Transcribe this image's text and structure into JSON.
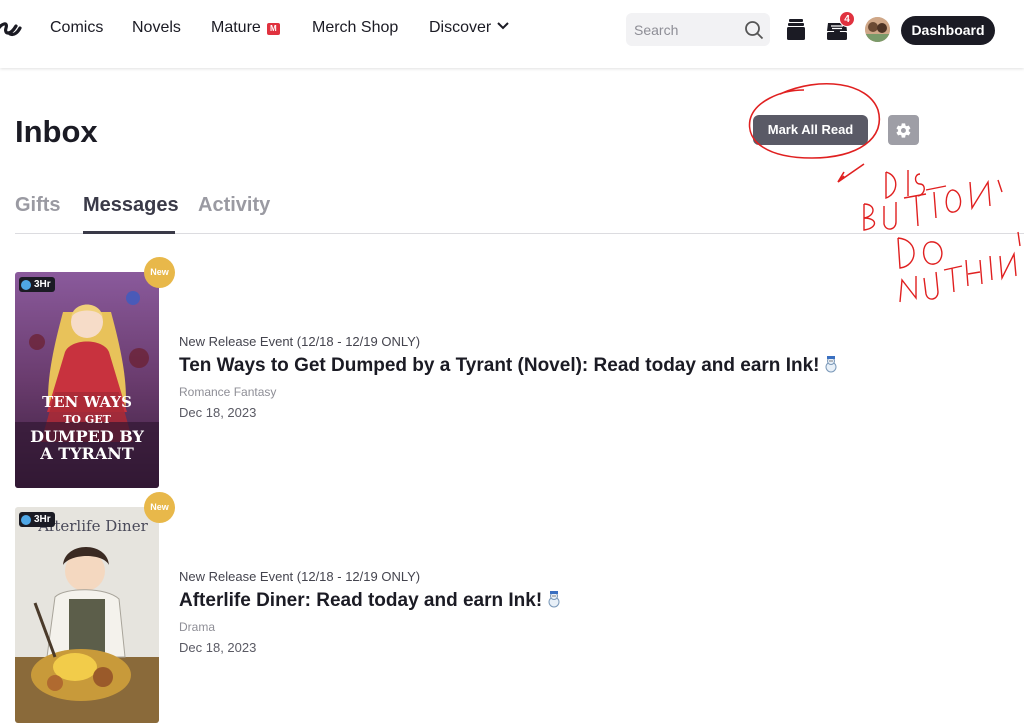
{
  "nav": {
    "logo_fragment": "s",
    "links": [
      "Comics",
      "Novels",
      "Mature",
      "Merch Shop",
      "Discover"
    ],
    "mature_badge": "M",
    "search_placeholder": "Search",
    "inbox_count": "4",
    "dashboard_label": "Dashboard"
  },
  "page": {
    "title": "Inbox",
    "mark_all_read": "Mark All Read",
    "tabs": [
      {
        "label": "Gifts",
        "active": false
      },
      {
        "label": "Messages",
        "active": true
      },
      {
        "label": "Activity",
        "active": false
      }
    ]
  },
  "messages": [
    {
      "event": "New Release Event (12/18 - 12/19 ONLY)",
      "title": "Ten Ways to Get Dumped by a Tyrant (Novel): Read today and earn Ink!",
      "genre": "Romance Fantasy",
      "date": "Dec 18, 2023",
      "badge": "New",
      "timer": "3Hr",
      "cover_title": [
        "TEN WAYS",
        "TO GET",
        "DUMPED BY",
        "A TYRANT"
      ]
    },
    {
      "event": "New Release Event (12/18 - 12/19 ONLY)",
      "title": "Afterlife Diner: Read today and earn Ink!",
      "genre": "Drama",
      "date": "Dec 18, 2023",
      "badge": "New",
      "timer": "3Hr",
      "cover_title": [
        "Afterlife Diner"
      ]
    }
  ],
  "annotation": {
    "handwritten_note": "DIS BUTTON DO NUTHIN'"
  },
  "colors": {
    "dark": "#1b1b24",
    "badge_red": "#e0323f",
    "new_badge": "#e8b84a",
    "annotation_red": "#e02020"
  }
}
